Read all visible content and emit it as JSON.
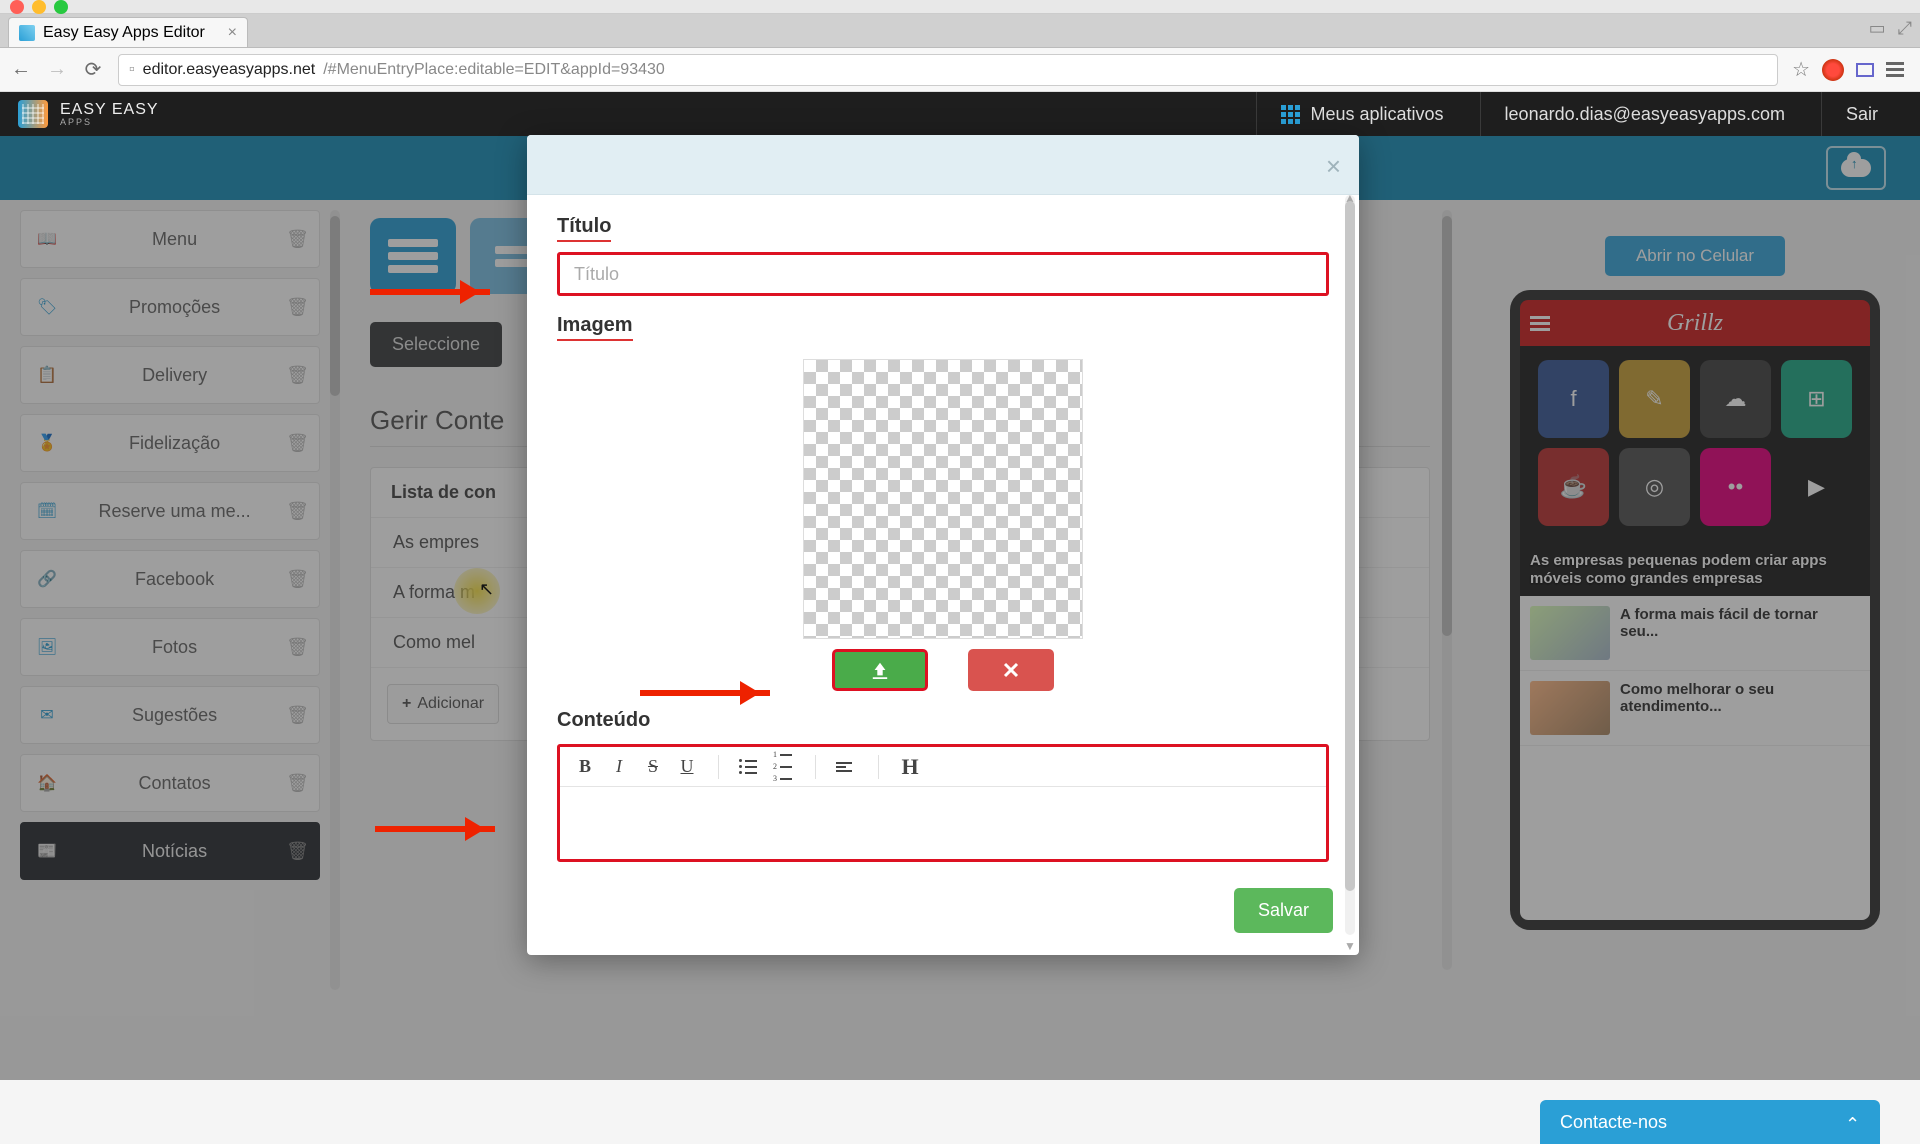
{
  "browser": {
    "tab_title": "Easy Easy Apps Editor",
    "url_host": "editor.easyeasyapps.net",
    "url_path": "/#MenuEntryPlace:editable=EDIT&appId=93430"
  },
  "header": {
    "brand_line1": "EASY EASY",
    "brand_line2": "APPS",
    "my_apps": "Meus aplicativos",
    "user_email": "leonardo.dias@easyeasyapps.com",
    "logout": "Sair"
  },
  "sidebar": {
    "items": [
      {
        "label": "Menu",
        "icon": "book"
      },
      {
        "label": "Promoções",
        "icon": "tag"
      },
      {
        "label": "Delivery",
        "icon": "clipboard"
      },
      {
        "label": "Fidelização",
        "icon": "badge"
      },
      {
        "label": "Reserve uma me...",
        "icon": "calendar"
      },
      {
        "label": "Facebook",
        "icon": "share"
      },
      {
        "label": "Fotos",
        "icon": "image"
      },
      {
        "label": "Sugestões",
        "icon": "mail"
      },
      {
        "label": "Contatos",
        "icon": "home"
      },
      {
        "label": "Notícias",
        "icon": "news",
        "active": true
      }
    ]
  },
  "center": {
    "dark_button": "Seleccione",
    "section_title": "Gerir Conte",
    "panel_header": "Lista de con",
    "rows": [
      "As empres",
      "A forma m",
      "Como mel"
    ],
    "add_button": "Adicionar"
  },
  "preview": {
    "open_button": "Abrir no Celular",
    "app_name": "Grillz",
    "hero_caption": "As empresas pequenas podem criar apps móveis como grandes empresas",
    "items": [
      "A forma mais fácil de tornar seu...",
      "Como melhorar o seu atendimento..."
    ]
  },
  "contact_tab": "Contacte-nos",
  "modal": {
    "title_label": "Título",
    "title_placeholder": "Título",
    "image_label": "Imagem",
    "content_label": "Conteúdo",
    "toolbar": {
      "b": "B",
      "i": "I",
      "s": "S",
      "u": "U",
      "h": "H"
    },
    "save": "Salvar"
  }
}
